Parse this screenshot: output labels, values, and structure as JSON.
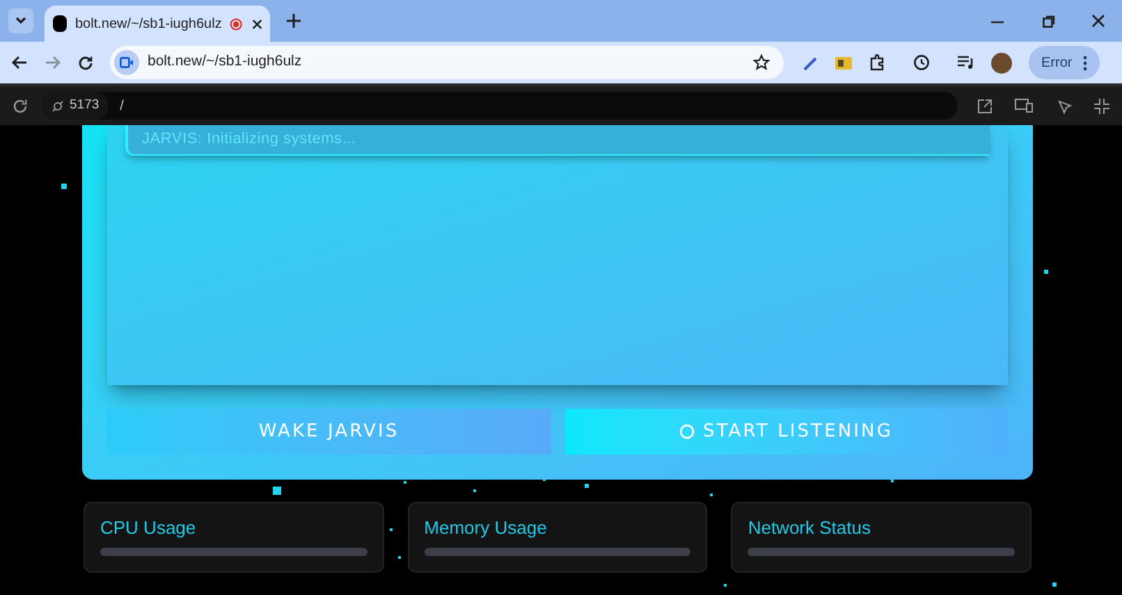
{
  "browser": {
    "tab": {
      "title": "bolt.new/~/sb1-iugh6ulz",
      "recording": true
    },
    "address": "bolt.new/~/sb1-iugh6ulz",
    "profile_button": "Error"
  },
  "preview_bar": {
    "port": "5173",
    "path": "/"
  },
  "panel": {
    "log": "JARVIS: Initializing systems...",
    "buttons": [
      {
        "label": "WAKE JARVIS",
        "kind": "plain"
      },
      {
        "label": "START LISTENING",
        "kind": "mic"
      }
    ]
  },
  "stats": [
    {
      "title": "CPU Usage",
      "level": 0
    },
    {
      "title": "Memory Usage",
      "level": 0
    },
    {
      "title": "Network Status",
      "level": 0
    }
  ]
}
